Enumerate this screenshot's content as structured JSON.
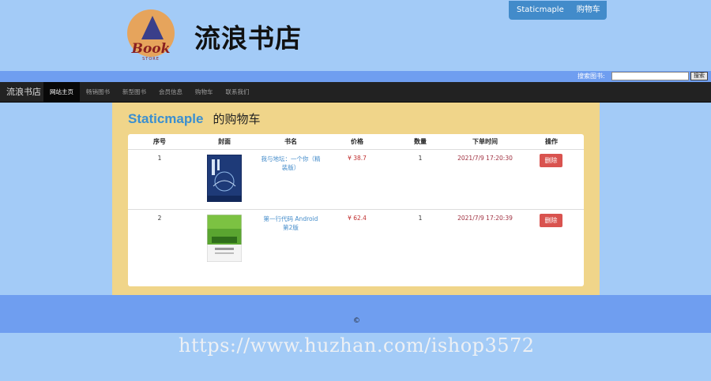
{
  "header": {
    "site_name": "流浪书店",
    "logo_word": "Book",
    "logo_sub": "STORE",
    "user_menu": {
      "username": "Staticmaple",
      "cart": "购物车"
    }
  },
  "search": {
    "label": "搜索图书:",
    "placeholder": "",
    "button": "搜索"
  },
  "navbar": {
    "brand": "流浪书店",
    "items": [
      "网站主页",
      "畅销图书",
      "新型图书",
      "会员信息",
      "购物车",
      "联系我们"
    ]
  },
  "cart": {
    "username": "Staticmaple",
    "title_suffix": "的购物车",
    "columns": [
      "序号",
      "封面",
      "书名",
      "价格",
      "数量",
      "下单时间",
      "操作"
    ],
    "rows": [
      {
        "index": "1",
        "name": "我与地坛：一个你（精装版）",
        "price": "¥ 38.7",
        "qty": "1",
        "time": "2021/7/9 17:20:30",
        "action": "删除"
      },
      {
        "index": "2",
        "name": "第一行代码 Android 第2版",
        "price": "¥ 62.4",
        "qty": "1",
        "time": "2021/7/9 17:20:39",
        "action": "删除"
      }
    ]
  },
  "footer": {
    "copyright": "©"
  },
  "watermark": "https://www.huzhan.com/ishop3572",
  "colors": {
    "page_bg": "#a3cbf7",
    "footer_bg": "#6f9ef0",
    "panel_bg": "#f0d58a",
    "accent": "#428bca",
    "danger": "#d9534f"
  }
}
